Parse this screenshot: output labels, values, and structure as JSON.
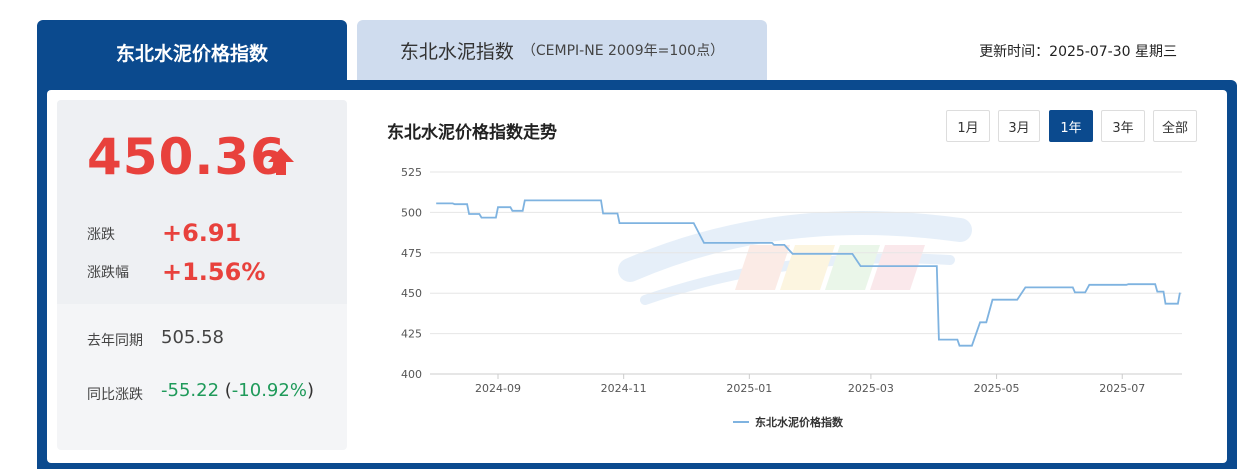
{
  "tabs": {
    "active": "东北水泥价格指数",
    "inactive_main": "东北水泥指数",
    "inactive_sub": "（CEMPI-NE 2009年=100点）"
  },
  "update_time": "更新时间：2025-07-30 星期三",
  "summary": {
    "price": "450.36",
    "change_label": "涨跌",
    "change_value": "+6.91",
    "change_pct_label": "涨跌幅",
    "change_pct_value": "+1.56%",
    "last_year_label": "去年同期",
    "last_year_value": "505.58",
    "yoy_label": "同比涨跌",
    "yoy_value": "-55.22",
    "yoy_pct_value": "-10.92%"
  },
  "range_buttons": [
    "1月",
    "3月",
    "1年",
    "3年",
    "全部"
  ],
  "active_range": "1年",
  "colors": {
    "brand": "#0b4a8e",
    "up": "#e8413c",
    "down": "#1f9a5a",
    "line": "#7fb3e0"
  },
  "chart_data": {
    "type": "line",
    "title": "东北水泥价格指数走势",
    "xlabel": "",
    "ylabel": "",
    "ylim": [
      400,
      525
    ],
    "yticks": [
      "400",
      "425",
      "450",
      "475",
      "500",
      "525"
    ],
    "xlim": [
      "2024-07-30",
      "2025-07-30"
    ],
    "xticks": [
      {
        "date": "2024-09-01",
        "label": "2024-09"
      },
      {
        "date": "2024-11-01",
        "label": "2024-11"
      },
      {
        "date": "2025-01-01",
        "label": "2025-01"
      },
      {
        "date": "2025-03-01",
        "label": "2025-03"
      },
      {
        "date": "2025-05-01",
        "label": "2025-05"
      },
      {
        "date": "2025-07-01",
        "label": "2025-07"
      }
    ],
    "grid": true,
    "legend": "bottom-center",
    "series": [
      {
        "name": "东北水泥价格指数",
        "points": [
          [
            "2024-08-02",
            505.6
          ],
          [
            "2024-08-10",
            505.6
          ],
          [
            "2024-08-11",
            505.1
          ],
          [
            "2024-08-17",
            505.1
          ],
          [
            "2024-08-18",
            499.0
          ],
          [
            "2024-08-23",
            499.0
          ],
          [
            "2024-08-24",
            496.8
          ],
          [
            "2024-08-31",
            496.8
          ],
          [
            "2024-09-01",
            503.2
          ],
          [
            "2024-09-07",
            503.2
          ],
          [
            "2024-09-08",
            501.0
          ],
          [
            "2024-09-13",
            501.0
          ],
          [
            "2024-09-14",
            507.4
          ],
          [
            "2024-10-21",
            507.4
          ],
          [
            "2024-10-22",
            499.3
          ],
          [
            "2024-10-29",
            499.3
          ],
          [
            "2024-10-30",
            493.4
          ],
          [
            "2024-12-05",
            493.4
          ],
          [
            "2024-12-10",
            481.1
          ],
          [
            "2025-01-12",
            481.1
          ],
          [
            "2025-01-13",
            479.9
          ],
          [
            "2025-01-18",
            479.9
          ],
          [
            "2025-01-22",
            474.3
          ],
          [
            "2025-02-20",
            474.3
          ],
          [
            "2025-02-24",
            466.8
          ],
          [
            "2025-04-02",
            466.8
          ],
          [
            "2025-04-03",
            421.3
          ],
          [
            "2025-04-12",
            421.3
          ],
          [
            "2025-04-13",
            417.5
          ],
          [
            "2025-04-19",
            417.5
          ],
          [
            "2025-04-23",
            432.0
          ],
          [
            "2025-04-26",
            432.0
          ],
          [
            "2025-04-29",
            446.0
          ],
          [
            "2025-05-11",
            446.0
          ],
          [
            "2025-05-15",
            453.6
          ],
          [
            "2025-06-07",
            453.6
          ],
          [
            "2025-06-08",
            450.5
          ],
          [
            "2025-06-13",
            450.5
          ],
          [
            "2025-06-15",
            455.2
          ],
          [
            "2025-07-03",
            455.2
          ],
          [
            "2025-07-04",
            455.6
          ],
          [
            "2025-07-17",
            455.6
          ],
          [
            "2025-07-18",
            451.0
          ],
          [
            "2025-07-21",
            451.0
          ],
          [
            "2025-07-22",
            443.5
          ],
          [
            "2025-07-28",
            443.5
          ],
          [
            "2025-07-29",
            450.4
          ]
        ]
      }
    ]
  }
}
